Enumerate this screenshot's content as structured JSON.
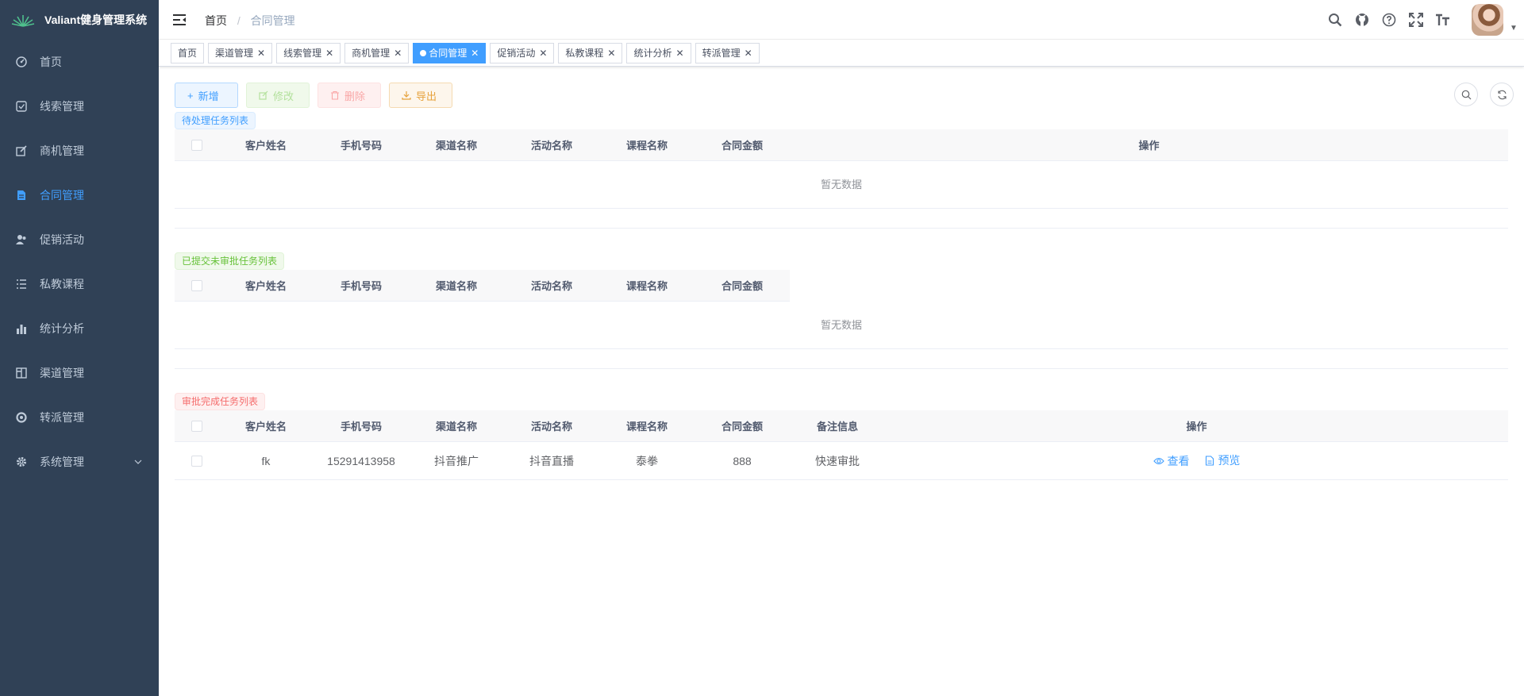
{
  "app": {
    "title": "Valiant健身管理系统"
  },
  "sidebar": {
    "items": [
      {
        "label": "首页",
        "icon": "dashboard-icon"
      },
      {
        "label": "线索管理",
        "icon": "clue-icon"
      },
      {
        "label": "商机管理",
        "icon": "edit-icon"
      },
      {
        "label": "合同管理",
        "icon": "document-icon",
        "active": true
      },
      {
        "label": "促销活动",
        "icon": "people-icon"
      },
      {
        "label": "私教课程",
        "icon": "list-icon"
      },
      {
        "label": "统计分析",
        "icon": "chart-icon"
      },
      {
        "label": "渠道管理",
        "icon": "table-icon"
      },
      {
        "label": "转派管理",
        "icon": "transfer-icon"
      },
      {
        "label": "系统管理",
        "icon": "gear-icon"
      }
    ]
  },
  "breadcrumb": {
    "home": "首页",
    "current": "合同管理"
  },
  "tags": [
    {
      "label": "首页",
      "closable": false
    },
    {
      "label": "渠道管理",
      "closable": true
    },
    {
      "label": "线索管理",
      "closable": true
    },
    {
      "label": "商机管理",
      "closable": true
    },
    {
      "label": "合同管理",
      "closable": true,
      "active": true
    },
    {
      "label": "促销活动",
      "closable": true
    },
    {
      "label": "私教课程",
      "closable": true
    },
    {
      "label": "统计分析",
      "closable": true
    },
    {
      "label": "转派管理",
      "closable": true
    }
  ],
  "toolbar": {
    "add": "新增",
    "edit": "修改",
    "delete": "删除",
    "export": "导出"
  },
  "sections": {
    "pending": {
      "tag": "待处理任务列表",
      "columns": [
        "客户姓名",
        "手机号码",
        "渠道名称",
        "活动名称",
        "课程名称",
        "合同金额"
      ],
      "action_header": "操作",
      "empty": "暂无数据"
    },
    "submitted": {
      "tag": "已提交未审批任务列表",
      "columns": [
        "客户姓名",
        "手机号码",
        "渠道名称",
        "活动名称",
        "课程名称",
        "合同金额"
      ],
      "empty": "暂无数据"
    },
    "approved": {
      "tag": "审批完成任务列表",
      "columns": [
        "客户姓名",
        "手机号码",
        "渠道名称",
        "活动名称",
        "课程名称",
        "合同金额",
        "备注信息"
      ],
      "action_header": "操作",
      "rows": [
        {
          "name": "fk",
          "phone": "15291413958",
          "channel": "抖音推广",
          "activity": "抖音直播",
          "course": "泰拳",
          "amount": "888",
          "remark": "快速审批",
          "view": "查看",
          "preview": "预览"
        }
      ]
    }
  },
  "colors": {
    "sidebar_bg": "#304156",
    "accent": "#409eff"
  }
}
